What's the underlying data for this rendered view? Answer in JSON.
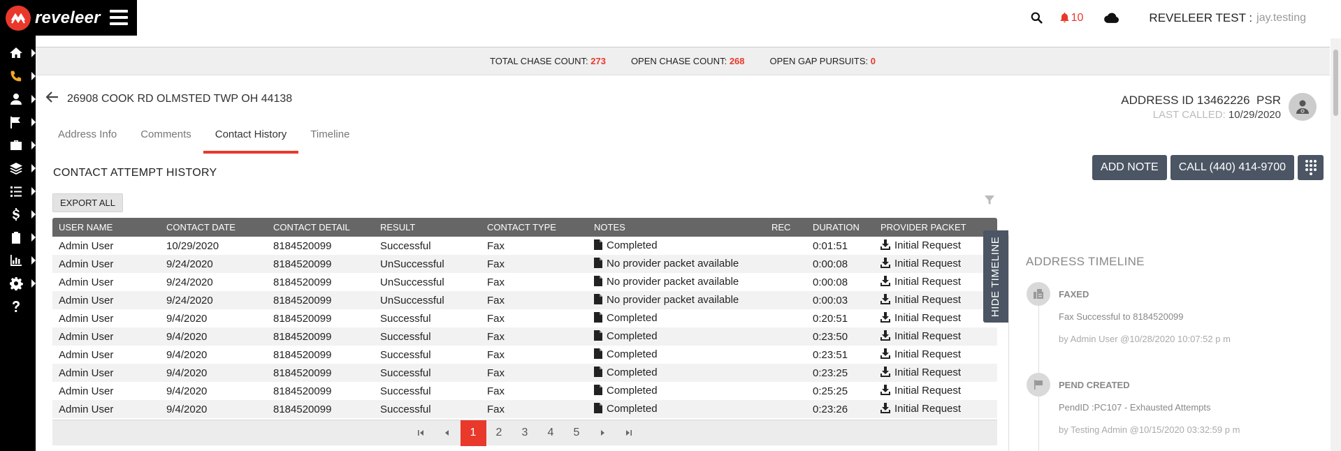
{
  "app": {
    "logo_text": "reveleer"
  },
  "nav": {
    "items": [
      "home-icon",
      "phone-icon",
      "user-icon",
      "flag-icon",
      "briefcase-icon",
      "layers-icon",
      "list-icon",
      "dollar-icon",
      "clipboard-icon",
      "chart-icon",
      "gear-icon",
      "help-icon"
    ],
    "active_index": 1
  },
  "topbar": {
    "notification_count": "10",
    "org_label": "REVELEER TEST :",
    "username": "jay.testing"
  },
  "counts": {
    "total_label": "TOTAL CHASE COUNT:",
    "total_value": "273",
    "open_label": "OPEN CHASE COUNT:",
    "open_value": "268",
    "gap_label": "OPEN GAP PURSUITS:",
    "gap_value": "0"
  },
  "address": {
    "text": "26908 COOK RD OLMSTED TWP OH 44138",
    "address_id": "ADDRESS ID 13462226",
    "psr": "PSR",
    "last_called_label": "LAST CALLED:",
    "last_called_value": "10/29/2020"
  },
  "tabs": [
    "Address Info",
    "Comments",
    "Contact History",
    "Timeline"
  ],
  "active_tab": 2,
  "actions": {
    "add_note": "ADD NOTE",
    "call": "CALL (440) 414-9700"
  },
  "section": {
    "title": "CONTACT ATTEMPT HISTORY",
    "export": "EXPORT ALL"
  },
  "table": {
    "columns": [
      "USER NAME",
      "CONTACT DATE",
      "CONTACT DETAIL",
      "RESULT",
      "CONTACT TYPE",
      "NOTES",
      "REC",
      "DURATION",
      "PROVIDER PACKET"
    ],
    "rows": [
      [
        "Admin User",
        "10/29/2020",
        "8184520099",
        "Successful",
        "Fax",
        "Completed",
        "",
        "0:01:51",
        "Initial Request"
      ],
      [
        "Admin User",
        "9/24/2020",
        "8184520099",
        "UnSuccessful",
        "Fax",
        "No provider packet available",
        "",
        "0:00:08",
        "Initial Request"
      ],
      [
        "Admin User",
        "9/24/2020",
        "8184520099",
        "UnSuccessful",
        "Fax",
        "No provider packet available",
        "",
        "0:00:08",
        "Initial Request"
      ],
      [
        "Admin User",
        "9/24/2020",
        "8184520099",
        "UnSuccessful",
        "Fax",
        "No provider packet available",
        "",
        "0:00:03",
        "Initial Request"
      ],
      [
        "Admin User",
        "9/4/2020",
        "8184520099",
        "Successful",
        "Fax",
        "Completed",
        "",
        "0:20:51",
        "Initial Request"
      ],
      [
        "Admin User",
        "9/4/2020",
        "8184520099",
        "Successful",
        "Fax",
        "Completed",
        "",
        "0:23:50",
        "Initial Request"
      ],
      [
        "Admin User",
        "9/4/2020",
        "8184520099",
        "Successful",
        "Fax",
        "Completed",
        "",
        "0:23:51",
        "Initial Request"
      ],
      [
        "Admin User",
        "9/4/2020",
        "8184520099",
        "Successful",
        "Fax",
        "Completed",
        "",
        "0:23:25",
        "Initial Request"
      ],
      [
        "Admin User",
        "9/4/2020",
        "8184520099",
        "Successful",
        "Fax",
        "Completed",
        "",
        "0:25:25",
        "Initial Request"
      ],
      [
        "Admin User",
        "9/4/2020",
        "8184520099",
        "Successful",
        "Fax",
        "Completed",
        "",
        "0:23:26",
        "Initial Request"
      ]
    ]
  },
  "pager": {
    "pages": [
      "1",
      "2",
      "3",
      "4",
      "5"
    ],
    "current": "1"
  },
  "timeline": {
    "toggle_label": "HIDE TIMELINE",
    "title": "ADDRESS TIMELINE",
    "events": [
      {
        "head": "FAXED",
        "text": "Fax Successful to 8184520099",
        "by": "by Admin User @10/28/2020 10:07:52 p m",
        "icon": "fax-icon"
      },
      {
        "head": "PEND CREATED",
        "text": "PendID :PC107 - Exhausted Attempts",
        "by": "by Testing Admin @10/15/2020 03:32:59 p m",
        "icon": "flag-icon"
      }
    ]
  },
  "colors": {
    "accent": "#e8392b",
    "dark_button": "#4b5563",
    "rail": "#000000"
  }
}
